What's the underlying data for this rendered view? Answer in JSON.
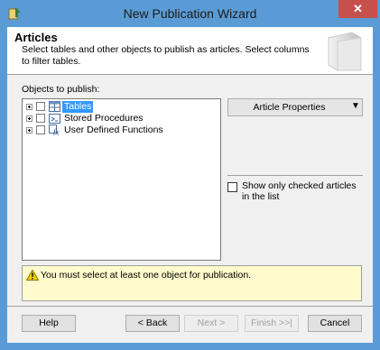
{
  "window": {
    "title": "New Publication Wizard",
    "close_glyph": "✕"
  },
  "header": {
    "title": "Articles",
    "description": "Select tables and other objects to publish as articles. Select columns to filter tables."
  },
  "objects_label": "Objects to publish:",
  "tree": [
    {
      "label": "Tables",
      "icon": "table-icon",
      "selected": true
    },
    {
      "label": "Stored Procedures",
      "icon": "stored-procedure-icon",
      "selected": false
    },
    {
      "label": "User Defined Functions",
      "icon": "function-icon",
      "selected": false
    }
  ],
  "article_properties": {
    "label": "Article Properties",
    "arrow": "▼"
  },
  "show_only_checked": {
    "label": "Show only checked articles in the list",
    "checked": false
  },
  "message": {
    "text": "You must select at least one object for publication."
  },
  "buttons": {
    "help": "Help",
    "back": "< Back",
    "next": "Next >",
    "finish": "Finish >>|",
    "cancel": "Cancel"
  },
  "colors": {
    "titlebar": "#5b9bd5",
    "selection": "#3399ff",
    "message_bg": "#fffbcc",
    "close": "#c7504c"
  }
}
